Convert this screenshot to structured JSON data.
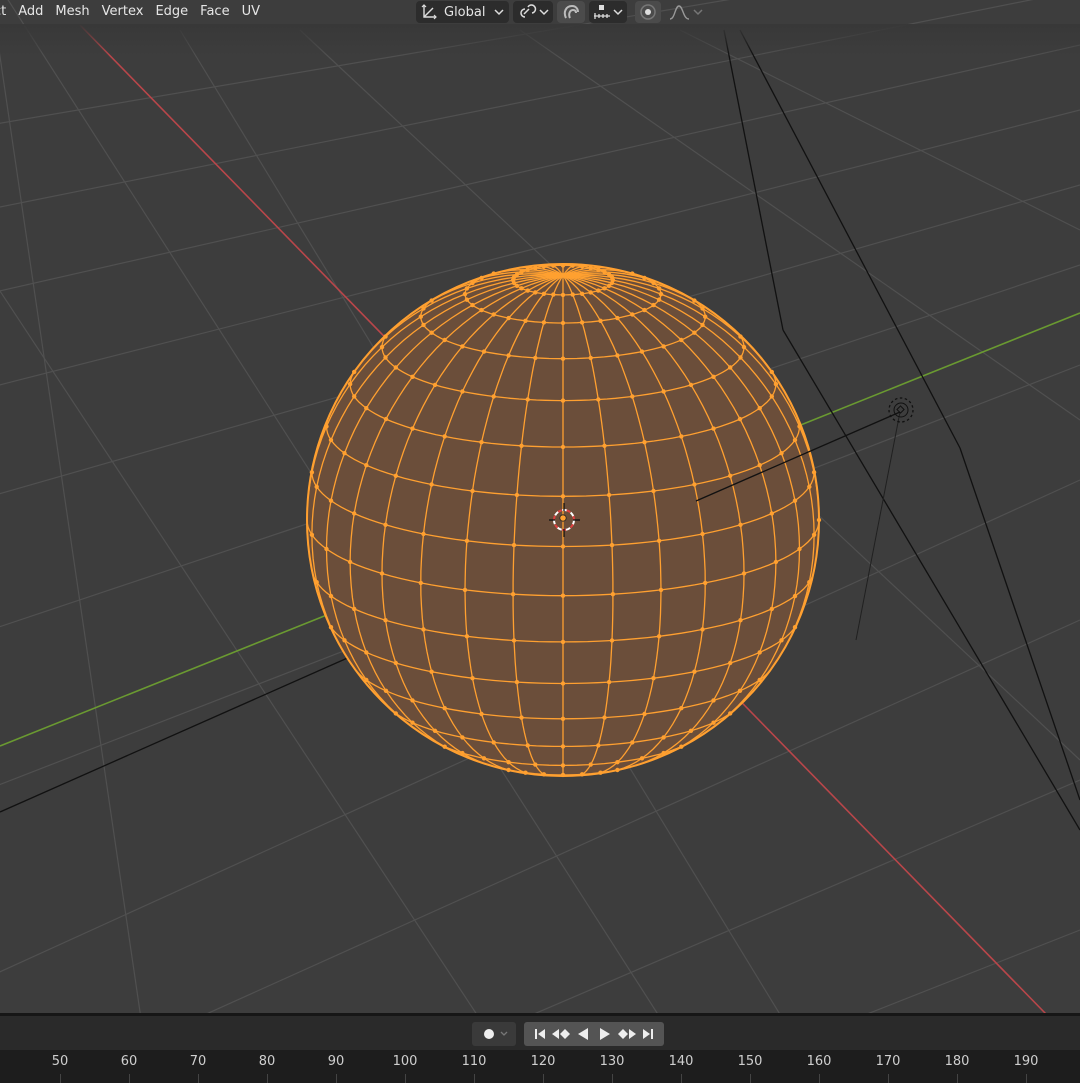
{
  "header": {
    "menu": [
      "ct",
      "Add",
      "Mesh",
      "Vertex",
      "Edge",
      "Face",
      "UV"
    ],
    "transform_orientation": "Global",
    "icons": [
      "orientation-axes-icon",
      "chevron-down-icon",
      "pivot-point-icon",
      "snap-magnet-icon",
      "snap-increment-icon",
      "proportional-editing-icon",
      "falloff-curve-icon"
    ]
  },
  "viewport": {
    "object": "UV sphere mesh in edit mode, all selected",
    "colors": {
      "background": "#3d3d3d",
      "grid": "#505050",
      "x_axis": "#b9464a",
      "y_axis": "#6a9a31",
      "selection_orange": "#ffa030",
      "face_fill": "#6b4e3a",
      "wire_black": "#111111"
    }
  },
  "timeline": {
    "playback_icons": [
      "keyframe-dot-icon",
      "jump-start-icon",
      "prev-keyframe-icon",
      "play-reverse-icon",
      "play-icon",
      "next-keyframe-icon",
      "jump-end-icon"
    ],
    "frames": [
      "50",
      "60",
      "70",
      "80",
      "90",
      "100",
      "110",
      "120",
      "130",
      "140",
      "150",
      "160",
      "170",
      "180",
      "190"
    ]
  }
}
